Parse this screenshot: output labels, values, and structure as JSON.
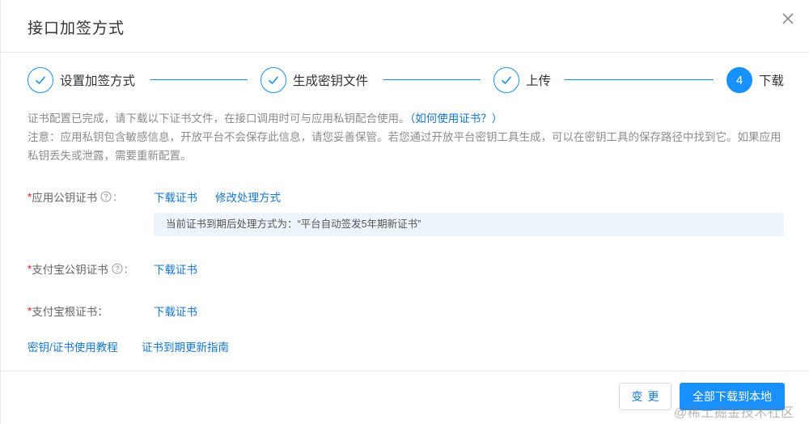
{
  "dialog": {
    "title": "接口加签方式",
    "close_icon": "close-icon"
  },
  "steps": [
    {
      "label": "设置加签方式",
      "status": "done"
    },
    {
      "label": "生成密钥文件",
      "status": "done"
    },
    {
      "label": "上传",
      "status": "done"
    },
    {
      "label": "下载",
      "status": "active",
      "number": "4"
    }
  ],
  "info": {
    "line1": "证书配置已完成，请下载以下证书文件，在接口调用时可与应用私钥配合使用。",
    "line1_link": "（如何使用证书？）",
    "line2": "注意：应用私钥包含敏感信息，开放平台不会保存此信息，请您妥善保管。若您通过开放平台密钥工具生成，可以在密钥工具的保存路径中找到它。如果应用私钥丢失或泄露，需要重新配置。"
  },
  "form": {
    "app_public_cert": {
      "required": "*",
      "label": "应用公钥证书",
      "colon": ":",
      "download": "下载证书",
      "modify": "修改处理方式",
      "notice": "当前证书到期后处理方式为：“平台自动签发5年期新证书”"
    },
    "alipay_public_cert": {
      "required": "*",
      "label": "支付宝公钥证书",
      "colon": ":",
      "download": "下载证书"
    },
    "alipay_root_cert": {
      "required": "*",
      "label": "支付宝根证书：",
      "download": "下载证书"
    }
  },
  "bottom_links": {
    "tutorial": "密钥/证书使用教程",
    "renew_guide": "证书到期更新指南"
  },
  "footer": {
    "change_label": "变更",
    "download_all_label": "全部下载到本地"
  },
  "watermark": "@稀土掘金技术社区",
  "colors": {
    "primary": "#1890ff",
    "link": "#1677d2",
    "required": "#f5222d",
    "notice_bg": "#eef4fb"
  }
}
